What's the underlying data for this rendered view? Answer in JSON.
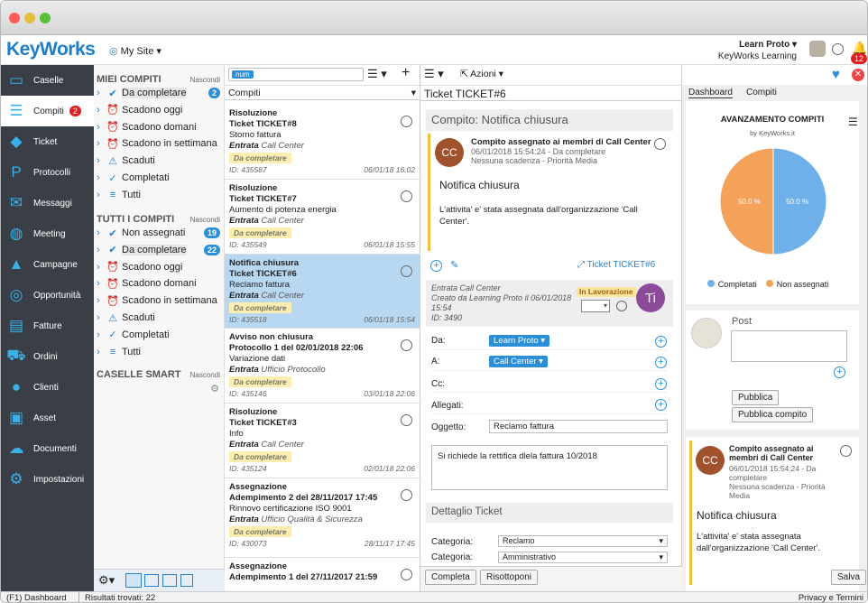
{
  "app": {
    "logo": "KeyWorks",
    "site": "My Site ▾",
    "user_name": "Learn Proto ▾",
    "org": "KeyWorks Learning",
    "notif_count": "12"
  },
  "sidebar": [
    {
      "label": "Caselle",
      "icon": "inbox-icon"
    },
    {
      "label": "Compiti",
      "icon": "tasks-icon",
      "badge": "2",
      "active": true
    },
    {
      "label": "Ticket",
      "icon": "ticket-icon"
    },
    {
      "label": "Protocolli",
      "icon": "protocol-icon"
    },
    {
      "label": "Messaggi",
      "icon": "envelope-icon"
    },
    {
      "label": "Meeting",
      "icon": "people-icon"
    },
    {
      "label": "Campagne",
      "icon": "campaign-icon"
    },
    {
      "label": "Opportunità",
      "icon": "target-icon"
    },
    {
      "label": "Fatture",
      "icon": "invoice-icon"
    },
    {
      "label": "Ordini",
      "icon": "cart-icon"
    },
    {
      "label": "Clienti",
      "icon": "person-icon"
    },
    {
      "label": "Asset",
      "icon": "asset-icon"
    },
    {
      "label": "Documenti",
      "icon": "cloud-icon"
    },
    {
      "label": "Impostazioni",
      "icon": "gear-icon"
    }
  ],
  "tree": {
    "my_tasks": "MIEI COMPITI",
    "hide": "Nascondi",
    "my_items": [
      {
        "label": "Da completare",
        "count": "2",
        "sel": true,
        "icon": "check-icon"
      },
      {
        "label": "Scadono oggi",
        "icon": "alarm-icon"
      },
      {
        "label": "Scadono domani",
        "icon": "alarm-icon"
      },
      {
        "label": "Scadono in settimana",
        "icon": "alarm-icon"
      },
      {
        "label": "Scaduti",
        "icon": "alarm-warning-icon"
      },
      {
        "label": "Completati",
        "icon": "done-icon"
      },
      {
        "label": "Tutti",
        "icon": "list-icon"
      }
    ],
    "all_tasks": "TUTTI I COMPITI",
    "all_items": [
      {
        "label": "Non assegnati",
        "count": "19",
        "icon": "check-icon"
      },
      {
        "label": "Da completare",
        "count": "22",
        "sel": true,
        "icon": "check-icon"
      },
      {
        "label": "Scadono oggi",
        "icon": "alarm-icon"
      },
      {
        "label": "Scadono domani",
        "icon": "alarm-icon"
      },
      {
        "label": "Scadono in settimana",
        "icon": "alarm-icon"
      },
      {
        "label": "Scaduti",
        "icon": "alarm-warning-icon"
      },
      {
        "label": "Completati",
        "icon": "done-icon"
      },
      {
        "label": "Tutti",
        "icon": "list-icon"
      }
    ],
    "smart": "CASELLE SMART"
  },
  "list": {
    "search_tag": "num",
    "header": "Compiti",
    "actions": "Azioni ▾",
    "cards": [
      {
        "t1": "Risoluzione",
        "t2": "Ticket TICKET#8",
        "t3": "Storno fattura",
        "entry": "Entrata",
        "who": "Call Center",
        "tag": "Da completare",
        "id": "ID: 435587",
        "date": "06/01/18 16:02"
      },
      {
        "t1": "Risoluzione",
        "t2": "Ticket TICKET#7",
        "t3": "Aumento di potenza energia",
        "entry": "Entrata",
        "who": "Call Center",
        "tag": "Da completare",
        "id": "ID: 435549",
        "date": "06/01/18 15:55"
      },
      {
        "t1": "Notifica chiusura",
        "t2": "Ticket TICKET#6",
        "t3": "Reclamo fattura",
        "entry": "Entrata",
        "who": "Call Center",
        "tag": "Da completare",
        "id": "ID: 435518",
        "date": "06/01/18 15:54",
        "sel": true
      },
      {
        "t1": "Avviso non chiusura",
        "t2": "Protocollo 1 del 02/01/2018 22:06",
        "t3": "Variazione dati",
        "entry": "Entrata",
        "who": "Ufficio Protocollo",
        "tag": "Da completare",
        "id": "ID: 435146",
        "date": "03/01/18 22:06"
      },
      {
        "t1": "Risoluzione",
        "t2": "Ticket TICKET#3",
        "t3": "Info",
        "entry": "Entrata",
        "who": "Call Center",
        "tag": "Da completare",
        "id": "ID: 435124",
        "date": "02/01/18 22:06"
      },
      {
        "t1": "Assegnazione",
        "t2": "Adempimento 2 del 28/11/2017 17:45",
        "t3": "Rinnovo certificazione ISO 9001",
        "entry": "Entrata",
        "who": "Ufficio Qualità & Sicurezza",
        "tag": "Da completare",
        "id": "ID: 430073",
        "date": "28/11/17 17:45"
      },
      {
        "t1": "Assegnazione",
        "t2": "Adempimento 1 del 27/11/2017 21:59",
        "t3": "",
        "entry": "",
        "who": "",
        "tag": "",
        "id": "",
        "date": ""
      }
    ]
  },
  "detail": {
    "header": "Ticket TICKET#6",
    "task_title": "Compito: Notifica chiusura",
    "notif_head": "Compito assegnato ai membri di Call Center",
    "notif_meta1": "06/01/2018 15:54:24 - Da completare",
    "notif_meta2": "Nessuna scadenza - Priorità Media",
    "avatar": "CC",
    "notif_title": "Notifica chiusura",
    "notif_body": "L'attivita' e' stata assegnata dall'organizzazione 'Call Center'.",
    "ticket_link": "Ticket TICKET#6",
    "entry1": "Entrata Call Center",
    "entry2": "Creato da Learning Proto il 06/01/2018 15:54",
    "entry3": "ID: 3490",
    "status": "In Lavorazione",
    "avatar2": "Ti",
    "da": "Da:",
    "da_val": "Learn Proto ▾",
    "a": "A:",
    "a_val": "Call Center ▾",
    "cc": "Cc:",
    "att": "Allegati:",
    "subj": "Oggetto:",
    "subj_val": "Reclamo fattura",
    "body": "Si richiede la rettifica dlela fattura 10/2018",
    "detail_sec": "Dettaglio Ticket",
    "cat": "Categoria:",
    "cat_val": "Reclamo",
    "cat2_val": "Amministrativo",
    "btn_complete": "Completa",
    "btn_reassign": "Risottoponi",
    "btn_save": "Salva"
  },
  "right": {
    "tab1": "Dashboard",
    "tab2": "Compiti",
    "chart_title": "AVANZAMENTO COMPITI",
    "chart_sub": "by KeyWorks.it",
    "post": "Post",
    "btn_pub": "Pubblica",
    "btn_pub_task": "Pubblica compito",
    "n_head": "Compito assegnato ai membri di Call Center",
    "n_meta1": "06/01/2018 15:54:24 - Da completare",
    "n_meta2": "Nessuna scadenza - Priorità Media",
    "n_title": "Notifica chiusura",
    "n_body": "L'attivita' e' stata assegnata dall'organizzazione 'Call Center'."
  },
  "chart_data": {
    "type": "pie",
    "title": "AVANZAMENTO COMPITI",
    "categories": [
      "Completati",
      "Non assegnati"
    ],
    "values": [
      50,
      50
    ],
    "labels": [
      "50.0 %",
      "50.0 %"
    ],
    "colors": [
      "#6fb0ea",
      "#f4a15a"
    ]
  },
  "status": {
    "left": "(F1) Dashboard",
    "results": "Risultati trovati: 22",
    "right": "Privacy e Termini"
  }
}
